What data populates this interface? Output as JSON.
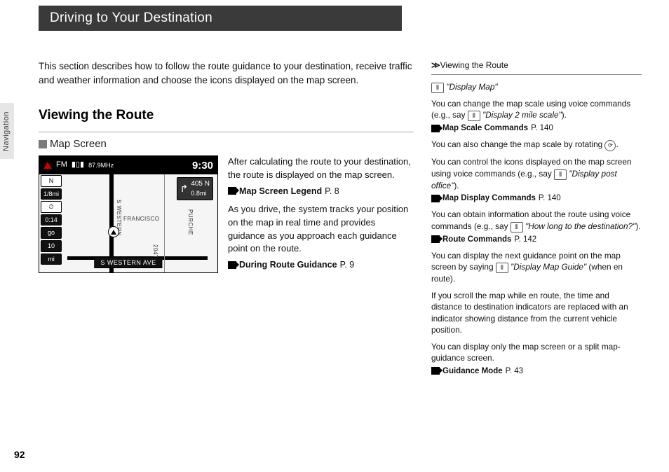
{
  "header": {
    "title": "Driving to Your Destination"
  },
  "sideTab": {
    "label": "Navigation"
  },
  "pageNumber": "92",
  "intro": "This section describes how to follow the route guidance to your destination, receive traffic and weather information and choose the icons displayed on the map screen.",
  "sectionTitle": "Viewing the Route",
  "subsection": {
    "title": "Map Screen"
  },
  "map": {
    "band": "FM",
    "signal": "▮▯▮",
    "freq": "87.9MHz",
    "clock": "9:30",
    "exit": {
      "road": "405 N",
      "dist": "0.8mi"
    },
    "left": {
      "north": "N",
      "scale": "1/8mi",
      "clockIcon": "⏱",
      "eta": "0:14",
      "go": "go",
      "dist": "10",
      "unit": "mi"
    },
    "streets": {
      "a": "S WESTERN",
      "b": "FRANCISCO",
      "c": "204TH",
      "d": "PURCHE",
      "ave": "S WESTERN AVE"
    }
  },
  "bodyText": {
    "p1": "After calculating the route to your destination, the route is displayed on the map screen.",
    "ref1": {
      "label": "Map Screen Legend",
      "page": "P. 8"
    },
    "p2": "As you drive, the system tracks your position on the map in real time and provides guidance as you approach each guidance point on the route.",
    "ref2": {
      "label": "During Route Guidance",
      "page": "P. 9"
    }
  },
  "sidebar": {
    "title": "Viewing the Route",
    "voiceCmd1": "\"Display Map\"",
    "p1a": "You can change the map scale using voice commands (e.g., say ",
    "p1b": "\"Display 2 mile scale\"",
    "p1c": ").",
    "ref1": {
      "label": "Map Scale Commands",
      "page": "P. 140"
    },
    "p2": "You can also change the map scale by rotating ",
    "p2b": ".",
    "p3a": "You can control the icons displayed on the map screen using voice commands (e.g., say ",
    "p3b": "\"Display post office\"",
    "p3c": ").",
    "ref2": {
      "label": "Map Display Commands",
      "page": "P. 140"
    },
    "p4a": "You can obtain information about the route using voice commands (e.g., say ",
    "p4b": "\"How long to the destination?\"",
    "p4c": ").",
    "ref3": {
      "label": "Route Commands",
      "page": "P. 142"
    },
    "p5a": "You can display the next guidance point on the map screen by saying ",
    "p5b": "\"Display Map Guide\"",
    "p5c": " (when en route).",
    "p6": "If you scroll the map while en route, the time and distance to destination indicators are replaced with an indicator showing distance from the current vehicle position.",
    "p7": "You can display only the map screen or a split map-guidance screen.",
    "ref4": {
      "label": "Guidance Mode",
      "page": "P. 43"
    }
  }
}
